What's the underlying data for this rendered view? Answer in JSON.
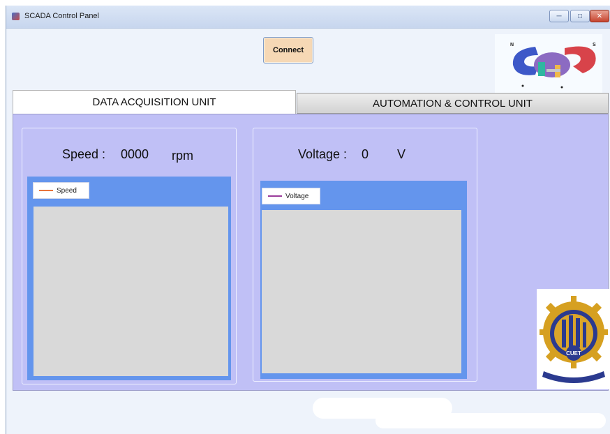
{
  "window": {
    "title": "SCADA Control Panel",
    "controls": {
      "minimize": "─",
      "maximize": "□",
      "close": "✕"
    }
  },
  "toolbar": {
    "connect_label": "Connect"
  },
  "logos": {
    "motor": "motor-magnet-icon",
    "university": "cuet-emblem-icon",
    "university_text": "CUET"
  },
  "tabs": [
    {
      "label": "DATA ACQUISITION UNIT",
      "active": true
    },
    {
      "label": "AUTOMATION & CONTROL UNIT",
      "active": false
    }
  ],
  "speed": {
    "label": "Speed :",
    "value": "0000",
    "unit": "rpm",
    "legend": "Speed",
    "series_color": "#e8743b"
  },
  "voltage": {
    "label": "Voltage :",
    "value": "0",
    "unit": "V",
    "legend": "Voltage",
    "series_color": "#9b3c9b"
  },
  "colors": {
    "tab_body": "#c0c0f6",
    "chart_bg": "#6495ed",
    "plot_area": "#d9d9d9",
    "connect_button": "#f6d8b5"
  }
}
